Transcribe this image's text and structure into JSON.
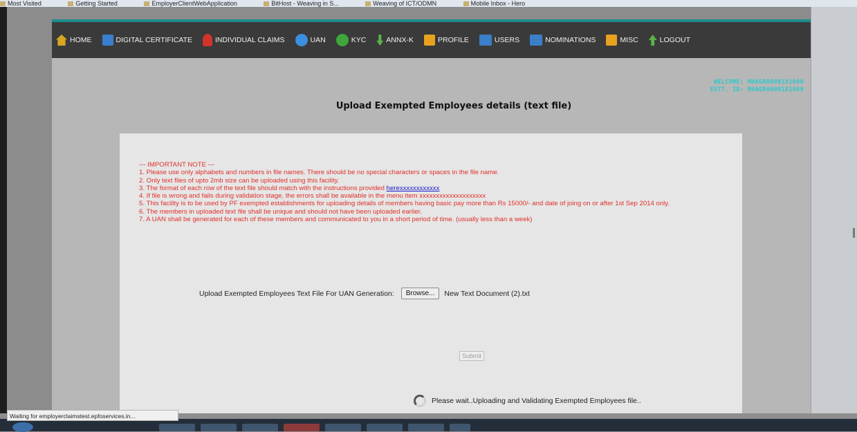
{
  "bookmarks": [
    "Most Visited",
    "Getting Started",
    "EmployerClientWebApplication",
    "BitHost - Weaving in S...",
    "Weaving of ICT/ODMN",
    "Mobile Inbox - Hero"
  ],
  "nav": {
    "items": [
      {
        "label": "HOME",
        "icon": "home-icon",
        "color": "#d9a520"
      },
      {
        "label": "DIGITAL CERTIFICATE",
        "icon": "certificate-icon",
        "color": "#3a7fd0"
      },
      {
        "label": "INDIVIDUAL CLAIMS",
        "icon": "person-icon",
        "color": "#d2342c"
      },
      {
        "label": "UAN",
        "icon": "document-icon",
        "color": "#3b8fe0"
      },
      {
        "label": "KYC",
        "icon": "user-icon",
        "color": "#3fa63a"
      },
      {
        "label": "ANNX-K",
        "icon": "download-icon",
        "color": "#5bb34a"
      },
      {
        "label": "PROFILE",
        "icon": "profile-icon",
        "color": "#e8a21f"
      },
      {
        "label": "USERS",
        "icon": "users-icon",
        "color": "#3a7fc8"
      },
      {
        "label": "NOMINATIONS",
        "icon": "nominations-icon",
        "color": "#3a7fc8"
      },
      {
        "label": "MISC",
        "icon": "misc-icon",
        "color": "#e8a21f"
      },
      {
        "label": "LOGOUT",
        "icon": "logout-icon",
        "color": "#5bb34a"
      }
    ]
  },
  "welcome": {
    "line1": "WELCOME: MHAGR0000181000",
    "line2": "ESTT. ID: MHAGR0000181000"
  },
  "page_title": "Upload Exempted Employees details (text file)",
  "notes": {
    "heading": "--- IMPORTANT NOTE ---",
    "item1": "1. Please use only alphabets and numbers in file names. There should be no special characters or spaces in the file name.",
    "item2": "2. Only text files of upto 2mb size can be uploaded using this facility.",
    "item3_prefix": "3. The format of each row of the text file should match with the instructions provided ",
    "item3_link": "herexxxxxxxxxxxx",
    "item4": "4. If file is wrong and fails during validation stage, the errors shall be available in the menu item xxxxxxxxxxxxxxxxxxxx",
    "item5": "5. This facility is to be used by PF exempted establishments for uploading details of members having basic pay more than Rs 15000/- and date of joing on or after 1st Sep 2014 only.",
    "item6": "6. The members in uploaded text file shall be unique and should not have been uploaded earlier.",
    "item7": "7. A UAN shall be generated for each of these members and communicated to you in a short period of time. (usually less than a week)"
  },
  "upload": {
    "label": "Upload Exempted Employees Text File For UAN Generation:",
    "browse_label": "Browse...",
    "file_name": "New Text Document (2).txt"
  },
  "submit_label": "Submit",
  "wait_message": "Please wait..Uploading and Validating Exempted Employees file..",
  "status_bar": "Waiting for employerclaimstest.epfoservices.in..."
}
